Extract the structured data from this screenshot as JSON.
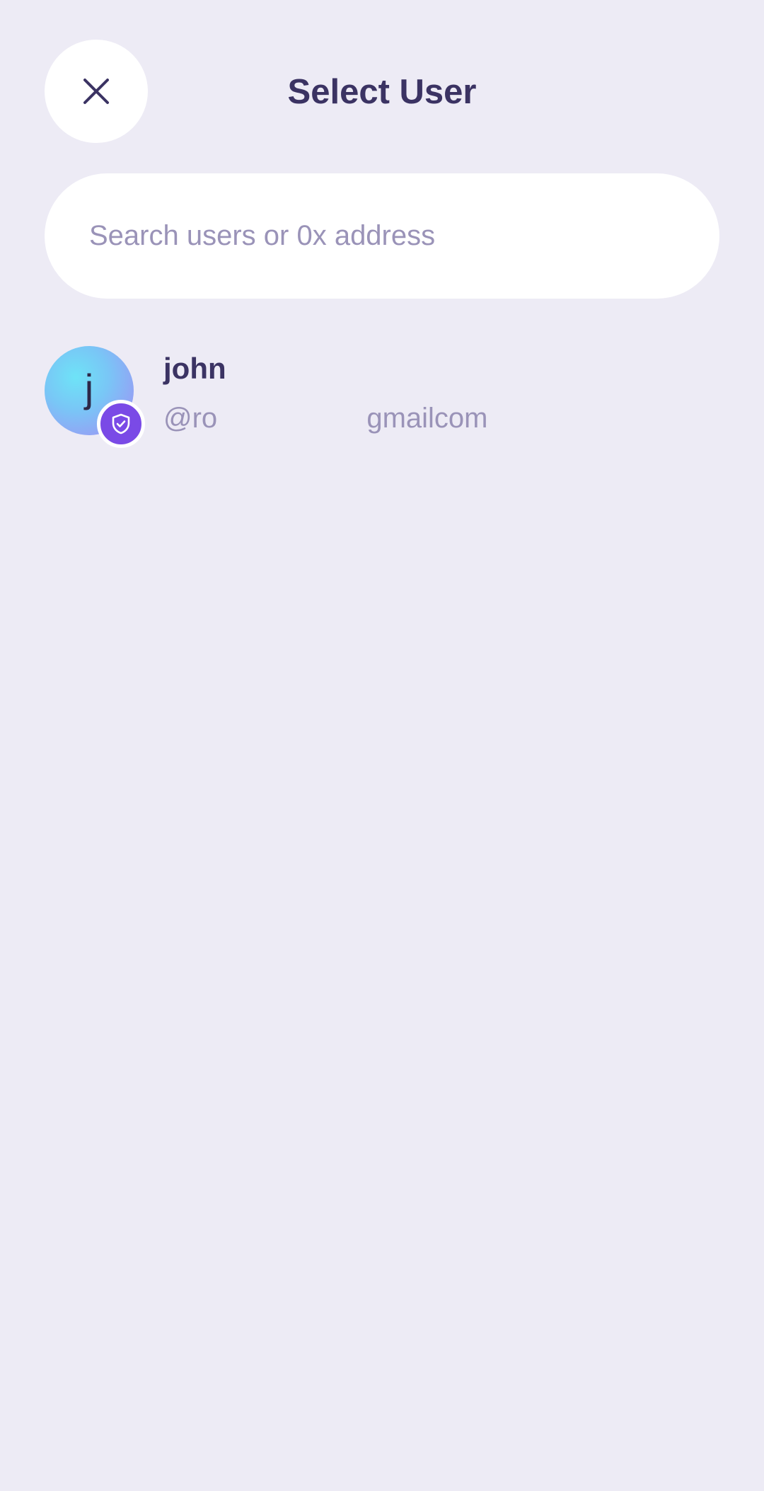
{
  "header": {
    "title": "Select User",
    "close_icon": "close-icon"
  },
  "search": {
    "placeholder": "Search users or 0x address",
    "value": ""
  },
  "users": [
    {
      "avatar_letter": "j",
      "name": "john",
      "handle": "@ro                   gmailcom",
      "badge_icon": "shield-check-icon"
    }
  ],
  "colors": {
    "background": "#edebf5",
    "title": "#3b3363",
    "muted": "#9a93b8",
    "badge": "#7a4ae6"
  }
}
